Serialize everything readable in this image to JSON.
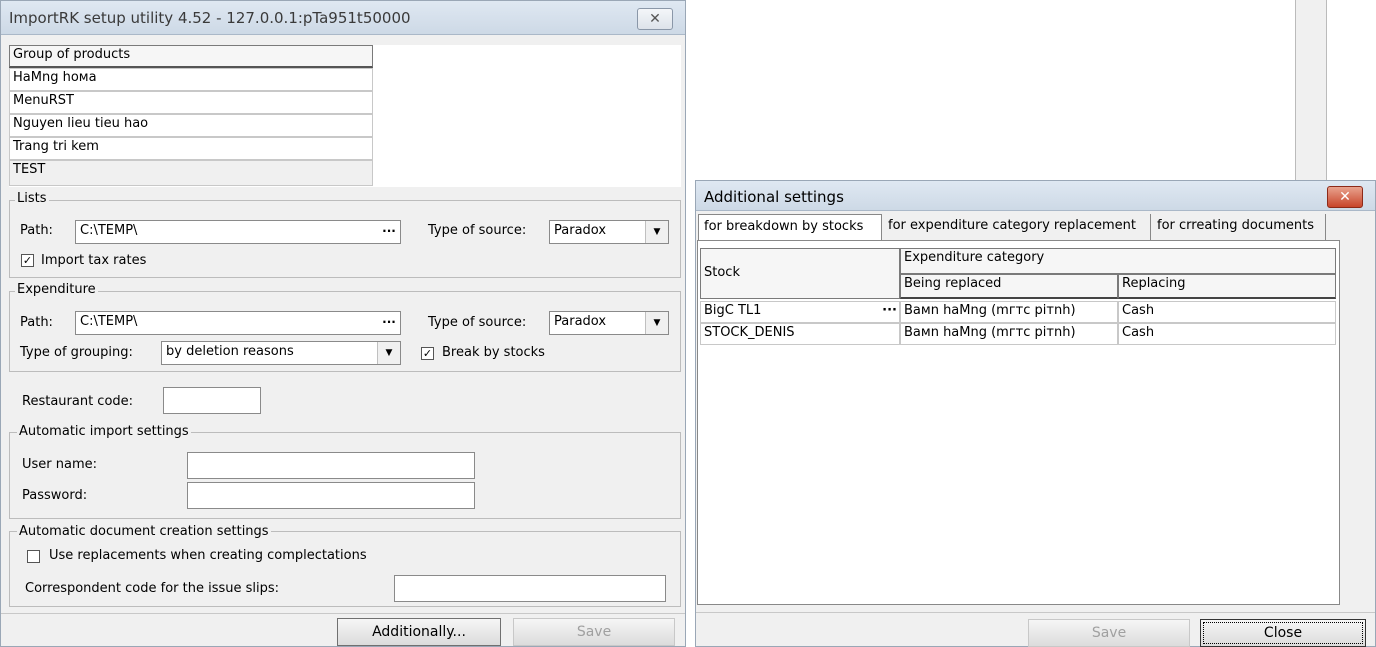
{
  "main_window": {
    "title": "ImportRK setup utility 4.52 - 127.0.0.1:pTa951t50000",
    "close_glyph": "✕",
    "groups_header": "Group of products",
    "groups": [
      "HaMng hoмa",
      "MenuRST",
      "Nguyen lieu tieu hao",
      "Trang tri kem",
      "TEST"
    ],
    "lists": {
      "legend": "Lists",
      "path_label": "Path:",
      "path_value": "C:\\TEMP\\",
      "source_label": "Type of source:",
      "source_value": "Paradox",
      "import_tax_label": "Import tax rates",
      "import_tax_checked": "✓"
    },
    "expenditure": {
      "legend": "Expenditure",
      "path_label": "Path:",
      "path_value": "C:\\TEMP\\",
      "source_label": "Type of source:",
      "source_value": "Paradox",
      "grouping_label": "Type of grouping:",
      "grouping_value": "by deletion reasons",
      "break_label": "Break by stocks",
      "break_checked": "✓"
    },
    "restaurant_code_label": "Restaurant code:",
    "auto_import": {
      "legend": "Automatic import settings",
      "user_label": "User name:",
      "password_label": "Password:"
    },
    "auto_doc": {
      "legend": "Automatic document creation settings",
      "replacements_label": "Use replacements when creating complectations",
      "correspondent_label": "Correspondent code for the issue slips:"
    },
    "additionally_button": "Additionally...",
    "save_button": "Save"
  },
  "dialog": {
    "title": "Additional settings",
    "close_glyph": "✕",
    "tabs": [
      "for breakdown by stocks",
      "for expenditure category replacement",
      "for crreating documents"
    ],
    "table": {
      "stock_header": "Stock",
      "category_header": "Expenditure category",
      "being_replaced_header": "Being replaced",
      "replacing_header": "Replacing",
      "rows": [
        {
          "stock": "BigC TL1",
          "being_replaced": "Baмn haMng (mгтc pітnh)",
          "replacing": "Cash"
        },
        {
          "stock": "STOCK_DENIS",
          "being_replaced": "Baмn haMng (mгтc pітnh)",
          "replacing": "Cash"
        }
      ]
    },
    "save_button": "Save",
    "close_button": "Close"
  }
}
